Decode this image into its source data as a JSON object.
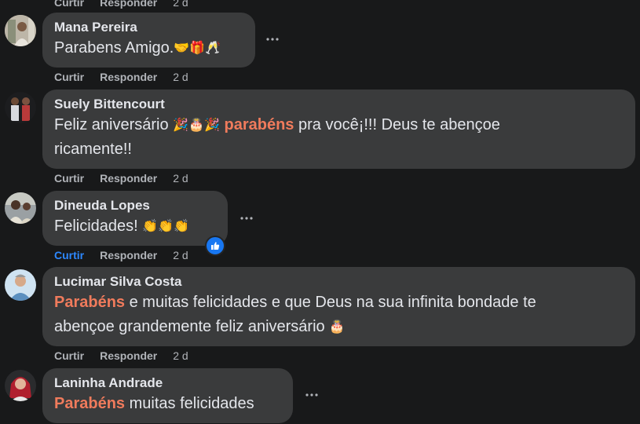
{
  "top_actions": {
    "like": "Curtir",
    "reply": "Responder",
    "time": "2 d"
  },
  "comments": [
    {
      "author": "Mana Pereira",
      "text_main": "Parabens Amigo.",
      "emojis": "🤝🎁🥂",
      "actions": {
        "like": "Curtir",
        "reply": "Responder",
        "time": "2 d"
      }
    },
    {
      "author": "Suely Bittencourt",
      "text_pre": "Feliz aniversário",
      "emojis": "🎉🎂🎉",
      "highlight": "parabéns",
      "text_post": "pra você¡!!! Deus te abençoe",
      "text_line2": "ricamente!!",
      "actions": {
        "like": "Curtir",
        "reply": "Responder",
        "time": "2 d"
      }
    },
    {
      "author": "Dineuda Lopes",
      "text_main": "Felicidades!",
      "emojis": "👏👏👏",
      "actions": {
        "like": "Curtir",
        "reply": "Responder",
        "time": "2 d"
      }
    },
    {
      "author": "Lucimar Silva Costa",
      "highlight": "Parabéns",
      "text_post": "e muitas felicidades e que Deus na sua infinita bondade te",
      "text_line2": "abençoe grandemente feliz aniversário",
      "emojis": "🎂",
      "actions": {
        "like": "Curtir",
        "reply": "Responder",
        "time": "2 d"
      }
    },
    {
      "author": "Laninha Andrade",
      "highlight": "Parabéns",
      "text_post": "muitas felicidades"
    }
  ],
  "colors": {
    "background": "#18191a",
    "bubble": "#3a3b3c",
    "text": "#e4e6eb",
    "muted": "#b0b3b8",
    "highlight": "#f07b5c",
    "like_active": "#2d88ff"
  },
  "icons": [
    "more-options-icon",
    "like-reaction-icon"
  ]
}
